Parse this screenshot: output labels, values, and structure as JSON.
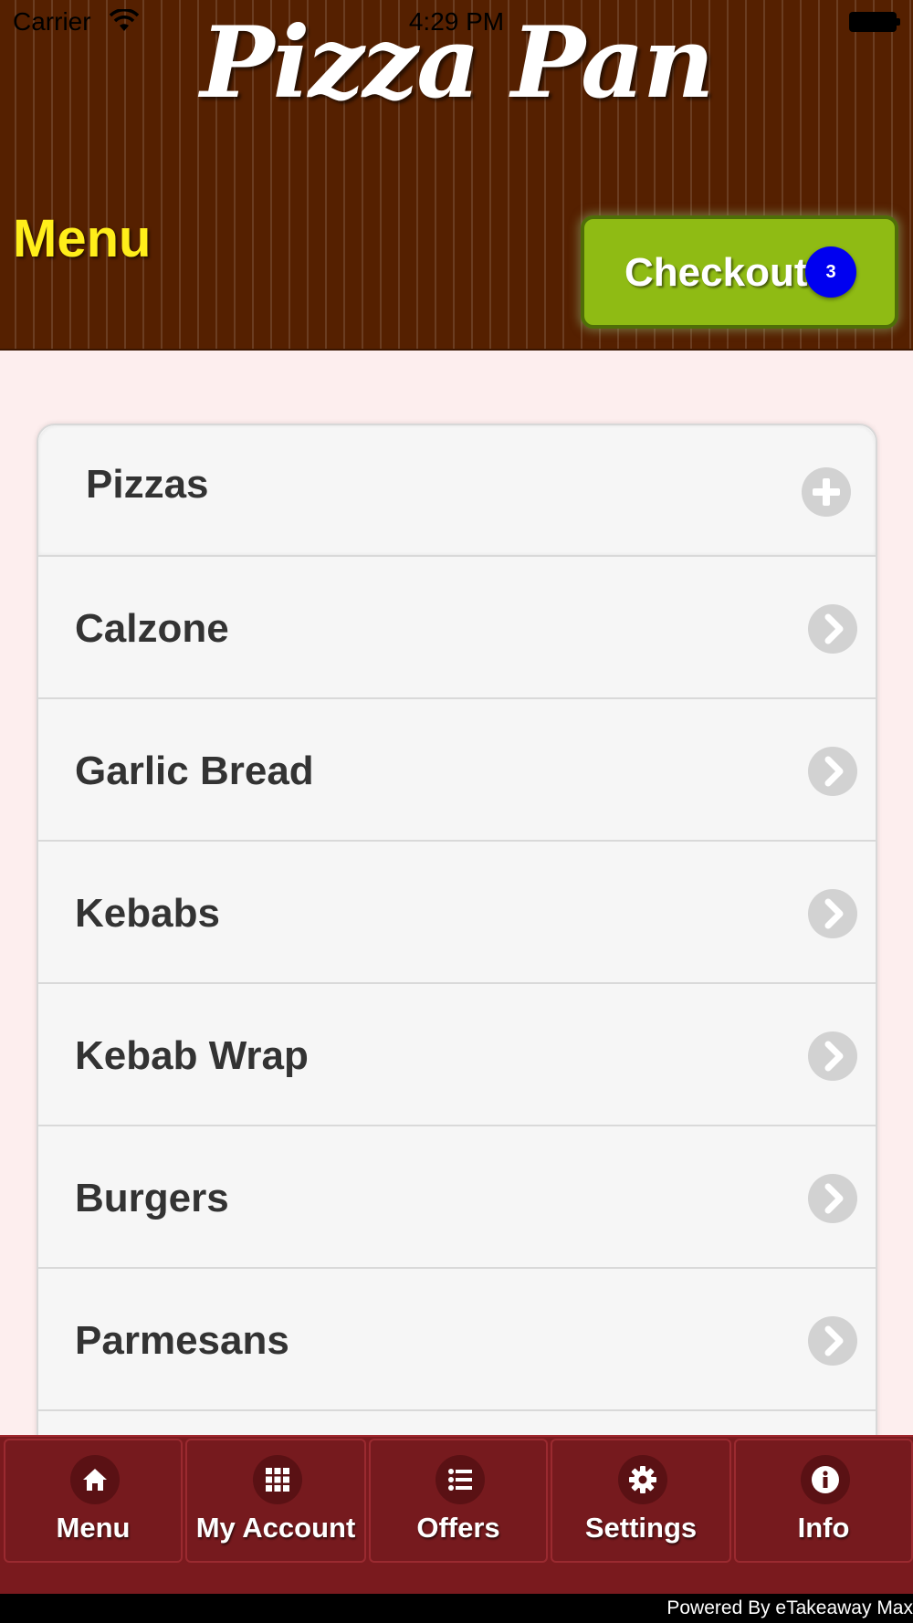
{
  "status_bar": {
    "carrier": "Carrier",
    "time": "4:29 PM"
  },
  "header": {
    "logo_text": "Pizza Pan",
    "title": "Menu",
    "checkout_label": "Checkout",
    "cart_count": "3"
  },
  "category": {
    "label": "Pizzas"
  },
  "menu_items": [
    {
      "label": "Calzone"
    },
    {
      "label": "Garlic Bread"
    },
    {
      "label": "Kebabs"
    },
    {
      "label": "Kebab Wrap"
    },
    {
      "label": "Burgers"
    },
    {
      "label": "Parmesans"
    }
  ],
  "bottom_nav": {
    "tabs": [
      {
        "label": "Menu",
        "icon": "home-icon"
      },
      {
        "label": "My Account",
        "icon": "grid-icon"
      },
      {
        "label": "Offers",
        "icon": "list-icon"
      },
      {
        "label": "Settings",
        "icon": "gear-icon"
      },
      {
        "label": "Info",
        "icon": "info-icon"
      }
    ]
  },
  "footer": {
    "powered_by": "Powered By eTakeaway Max"
  },
  "colors": {
    "header_bg": "#552000",
    "title_yellow": "#ffee1a",
    "checkout_green": "#8fbb14",
    "badge_blue": "#0000f0",
    "nav_bg": "#7a1a1e",
    "page_bg": "#fdeeee"
  }
}
